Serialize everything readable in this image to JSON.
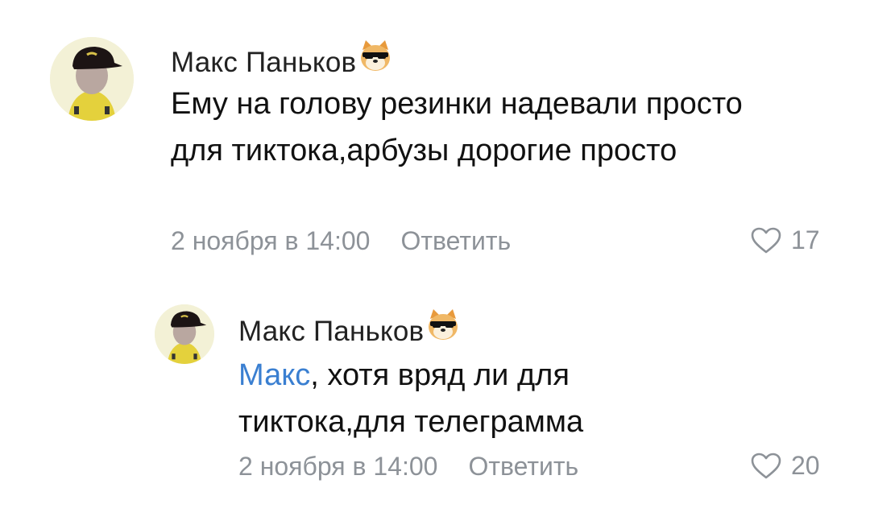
{
  "comments": [
    {
      "author": "Макс Паньков",
      "badge_icon": "doge-sunglasses-icon",
      "text": "Ему на голову резинки надевали просто для тиктока,арбузы дорогие просто",
      "date": "2 ноября в 14:00",
      "reply_label": "Ответить",
      "likes": "17"
    },
    {
      "author": "Макс Паньков",
      "badge_icon": "doge-sunglasses-icon",
      "mention": "Макс",
      "text": ", хотя вряд ли для тиктока,для телеграмма",
      "date": "2 ноября в 14:00",
      "reply_label": "Ответить",
      "likes": "20"
    }
  ],
  "colors": {
    "mention": "#3a7fd1",
    "meta": "#8d9298",
    "text": "#111111"
  }
}
